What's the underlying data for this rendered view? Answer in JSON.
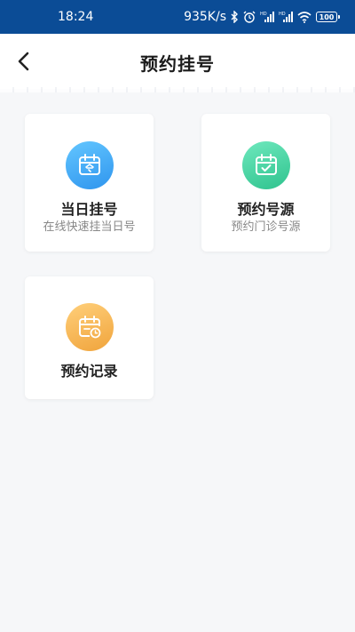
{
  "status_bar": {
    "time": "18:24",
    "network_speed": "935K/s",
    "battery": "100",
    "icons": [
      "bluetooth-icon",
      "alarm-icon",
      "signal-hd-icon",
      "signal-hd-icon",
      "wifi-icon",
      "battery-icon"
    ]
  },
  "header": {
    "title": "预约挂号",
    "back_icon": "chevron-left-icon"
  },
  "cards": [
    {
      "title": "当日挂号",
      "subtitle": "在线快速挂当日号",
      "icon": "calendar-today-icon",
      "color": "#3aa6f5"
    },
    {
      "title": "预约号源",
      "subtitle": "预约门诊号源",
      "icon": "calendar-check-icon",
      "color": "#3ccf9c"
    },
    {
      "title": "预约记录",
      "subtitle": "",
      "icon": "calendar-clock-icon",
      "color": "#f5b04a"
    }
  ]
}
